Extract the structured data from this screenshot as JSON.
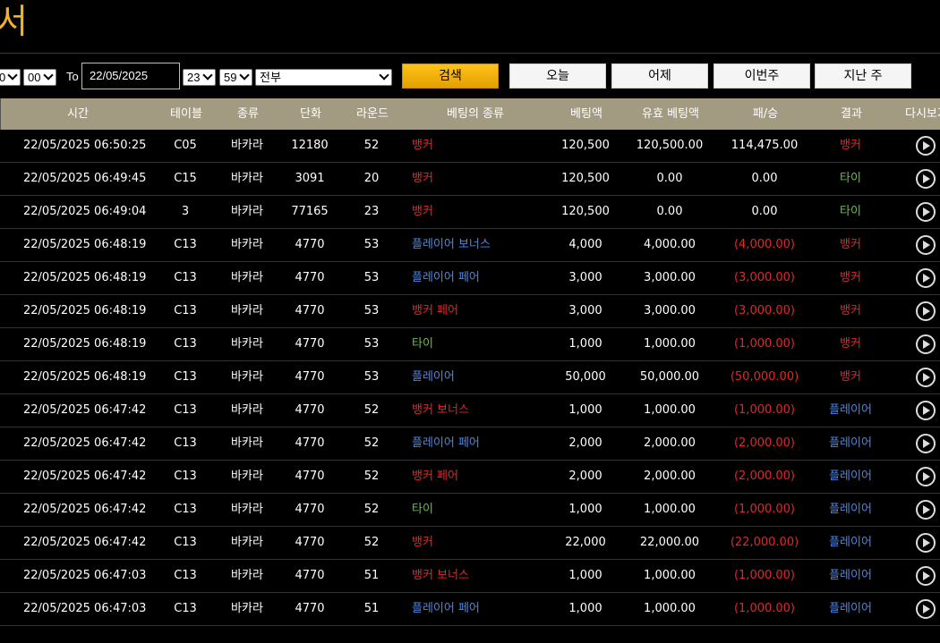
{
  "page": {
    "title": "서"
  },
  "filters": {
    "from_hour_partial": "0",
    "from_minute": "00",
    "to_label": "To",
    "to_date": "22/05/2025",
    "to_hour": "23",
    "to_minute": "59",
    "game_type": "전부",
    "buttons": {
      "search": "검색",
      "today": "오늘",
      "yesterday": "어제",
      "this_week": "이번주",
      "last_week": "지난 주"
    }
  },
  "table": {
    "headers": [
      "시간",
      "테이블",
      "종류",
      "단화",
      "라운드",
      "베팅의 종류",
      "베팅액",
      "유효 베팅액",
      "패/승",
      "결과",
      "다시보기"
    ],
    "rows": [
      {
        "time": "22/05/2025 06:50:25",
        "table": "C05",
        "kind": "바카라",
        "shoe": "12180",
        "round": "52",
        "bet_type": "뱅커",
        "bet_color": "red",
        "amount": "120,500",
        "valid": "120,500.00",
        "win_loss": "114,475.00",
        "wl_neg": false,
        "result": "뱅커",
        "result_color": "red"
      },
      {
        "time": "22/05/2025 06:49:45",
        "table": "C15",
        "kind": "바카라",
        "shoe": "3091",
        "round": "20",
        "bet_type": "뱅커",
        "bet_color": "red",
        "amount": "120,500",
        "valid": "0.00",
        "win_loss": "0.00",
        "wl_neg": false,
        "result": "타이",
        "result_color": "green"
      },
      {
        "time": "22/05/2025 06:49:04",
        "table": "3",
        "kind": "바카라",
        "shoe": "77165",
        "round": "23",
        "bet_type": "뱅커",
        "bet_color": "red",
        "amount": "120,500",
        "valid": "0.00",
        "win_loss": "0.00",
        "wl_neg": false,
        "result": "타이",
        "result_color": "green"
      },
      {
        "time": "22/05/2025 06:48:19",
        "table": "C13",
        "kind": "바카라",
        "shoe": "4770",
        "round": "53",
        "bet_type": "플레이어 보너스",
        "bet_color": "blue",
        "amount": "4,000",
        "valid": "4,000.00",
        "win_loss": "(4,000.00)",
        "wl_neg": true,
        "result": "뱅커",
        "result_color": "red"
      },
      {
        "time": "22/05/2025 06:48:19",
        "table": "C13",
        "kind": "바카라",
        "shoe": "4770",
        "round": "53",
        "bet_type": "플레이어 페어",
        "bet_color": "blue",
        "amount": "3,000",
        "valid": "3,000.00",
        "win_loss": "(3,000.00)",
        "wl_neg": true,
        "result": "뱅커",
        "result_color": "red"
      },
      {
        "time": "22/05/2025 06:48:19",
        "table": "C13",
        "kind": "바카라",
        "shoe": "4770",
        "round": "53",
        "bet_type": "뱅커 페어",
        "bet_color": "red",
        "amount": "3,000",
        "valid": "3,000.00",
        "win_loss": "(3,000.00)",
        "wl_neg": true,
        "result": "뱅커",
        "result_color": "red"
      },
      {
        "time": "22/05/2025 06:48:19",
        "table": "C13",
        "kind": "바카라",
        "shoe": "4770",
        "round": "53",
        "bet_type": "타이",
        "bet_color": "green",
        "amount": "1,000",
        "valid": "1,000.00",
        "win_loss": "(1,000.00)",
        "wl_neg": true,
        "result": "뱅커",
        "result_color": "red"
      },
      {
        "time": "22/05/2025 06:48:19",
        "table": "C13",
        "kind": "바카라",
        "shoe": "4770",
        "round": "53",
        "bet_type": "플레이어",
        "bet_color": "blue",
        "amount": "50,000",
        "valid": "50,000.00",
        "win_loss": "(50,000.00)",
        "wl_neg": true,
        "result": "뱅커",
        "result_color": "red"
      },
      {
        "time": "22/05/2025 06:47:42",
        "table": "C13",
        "kind": "바카라",
        "shoe": "4770",
        "round": "52",
        "bet_type": "뱅커 보너스",
        "bet_color": "red",
        "amount": "1,000",
        "valid": "1,000.00",
        "win_loss": "(1,000.00)",
        "wl_neg": true,
        "result": "플레이어",
        "result_color": "blue"
      },
      {
        "time": "22/05/2025 06:47:42",
        "table": "C13",
        "kind": "바카라",
        "shoe": "4770",
        "round": "52",
        "bet_type": "플레이어 페어",
        "bet_color": "blue",
        "amount": "2,000",
        "valid": "2,000.00",
        "win_loss": "(2,000.00)",
        "wl_neg": true,
        "result": "플레이어",
        "result_color": "blue"
      },
      {
        "time": "22/05/2025 06:47:42",
        "table": "C13",
        "kind": "바카라",
        "shoe": "4770",
        "round": "52",
        "bet_type": "뱅커 페어",
        "bet_color": "red",
        "amount": "2,000",
        "valid": "2,000.00",
        "win_loss": "(2,000.00)",
        "wl_neg": true,
        "result": "플레이어",
        "result_color": "blue"
      },
      {
        "time": "22/05/2025 06:47:42",
        "table": "C13",
        "kind": "바카라",
        "shoe": "4770",
        "round": "52",
        "bet_type": "타이",
        "bet_color": "green",
        "amount": "1,000",
        "valid": "1,000.00",
        "win_loss": "(1,000.00)",
        "wl_neg": true,
        "result": "플레이어",
        "result_color": "blue"
      },
      {
        "time": "22/05/2025 06:47:42",
        "table": "C13",
        "kind": "바카라",
        "shoe": "4770",
        "round": "52",
        "bet_type": "뱅커",
        "bet_color": "red",
        "amount": "22,000",
        "valid": "22,000.00",
        "win_loss": "(22,000.00)",
        "wl_neg": true,
        "result": "플레이어",
        "result_color": "blue"
      },
      {
        "time": "22/05/2025 06:47:03",
        "table": "C13",
        "kind": "바카라",
        "shoe": "4770",
        "round": "51",
        "bet_type": "뱅커 보너스",
        "bet_color": "red",
        "amount": "1,000",
        "valid": "1,000.00",
        "win_loss": "(1,000.00)",
        "wl_neg": true,
        "result": "플레이어",
        "result_color": "blue"
      },
      {
        "time": "22/05/2025 06:47:03",
        "table": "C13",
        "kind": "바카라",
        "shoe": "4770",
        "round": "51",
        "bet_type": "플레이어 페어",
        "bet_color": "blue",
        "amount": "1,000",
        "valid": "1,000.00",
        "win_loss": "(1,000.00)",
        "wl_neg": true,
        "result": "플레이어",
        "result_color": "blue"
      }
    ]
  }
}
